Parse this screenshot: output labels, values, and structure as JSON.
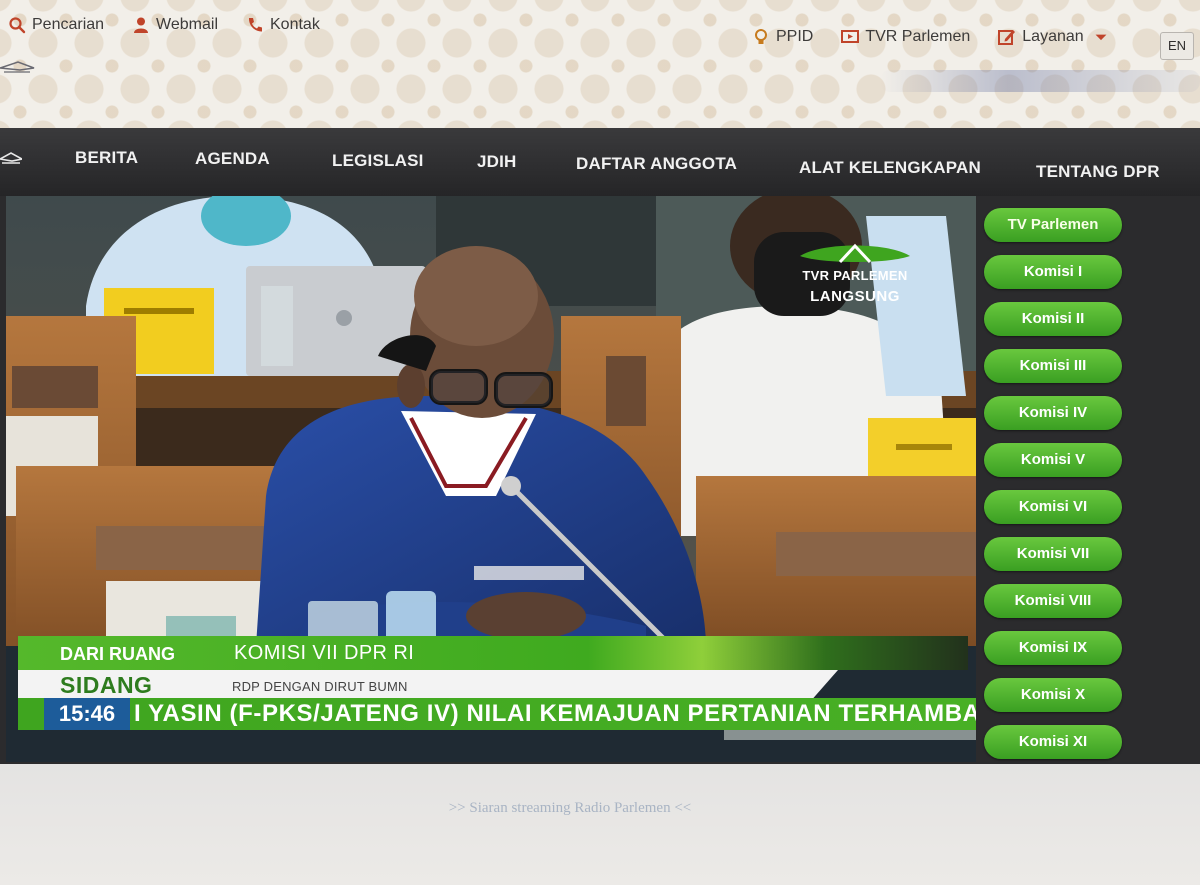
{
  "topbar": {
    "links_left": [
      {
        "label": "Pencarian",
        "icon": "search-icon"
      },
      {
        "label": "Webmail",
        "icon": "user-icon"
      },
      {
        "label": "Kontak",
        "icon": "phone-icon"
      }
    ],
    "links_right": [
      {
        "label": "PPID",
        "icon": "lightbulb-icon"
      },
      {
        "label": "TVR Parlemen",
        "icon": "tv-icon"
      },
      {
        "label": "Layanan",
        "icon": "edit-icon"
      }
    ],
    "lang": "EN"
  },
  "nav": {
    "items": [
      "BERITA",
      "AGENDA",
      "LEGISLASI",
      "JDIH",
      "DAFTAR ANGGOTA",
      "ALAT KELENGKAPAN",
      "TENTANG DPR"
    ]
  },
  "player": {
    "badge_title": "TVR PARLEMEN",
    "badge_sub": "LANGSUNG",
    "from_room": "DARI RUANG",
    "committee": "KOMISI VII DPR RI",
    "session": "SIDANG",
    "meeting": "RDP DENGAN DIRUT BUMN",
    "time": "15:46",
    "ticker": "I YASIN (F-PKS/JATENG IV) NILAI KEMAJUAN PERTANIAN TERHAMBAT"
  },
  "commissions": [
    "TV Parlemen",
    "Komisi I",
    "Komisi II",
    "Komisi III",
    "Komisi IV",
    "Komisi V",
    "Komisi VI",
    "Komisi VII",
    "Komisi VIII",
    "Komisi IX",
    "Komisi X",
    "Komisi XI"
  ],
  "footer": {
    "radio_link": ">> Siaran streaming Radio Parlemen <<"
  },
  "colors": {
    "nav_bg": "#2b2b2d",
    "green": "#3faa1f",
    "clock_blue": "#1d5c9a"
  }
}
